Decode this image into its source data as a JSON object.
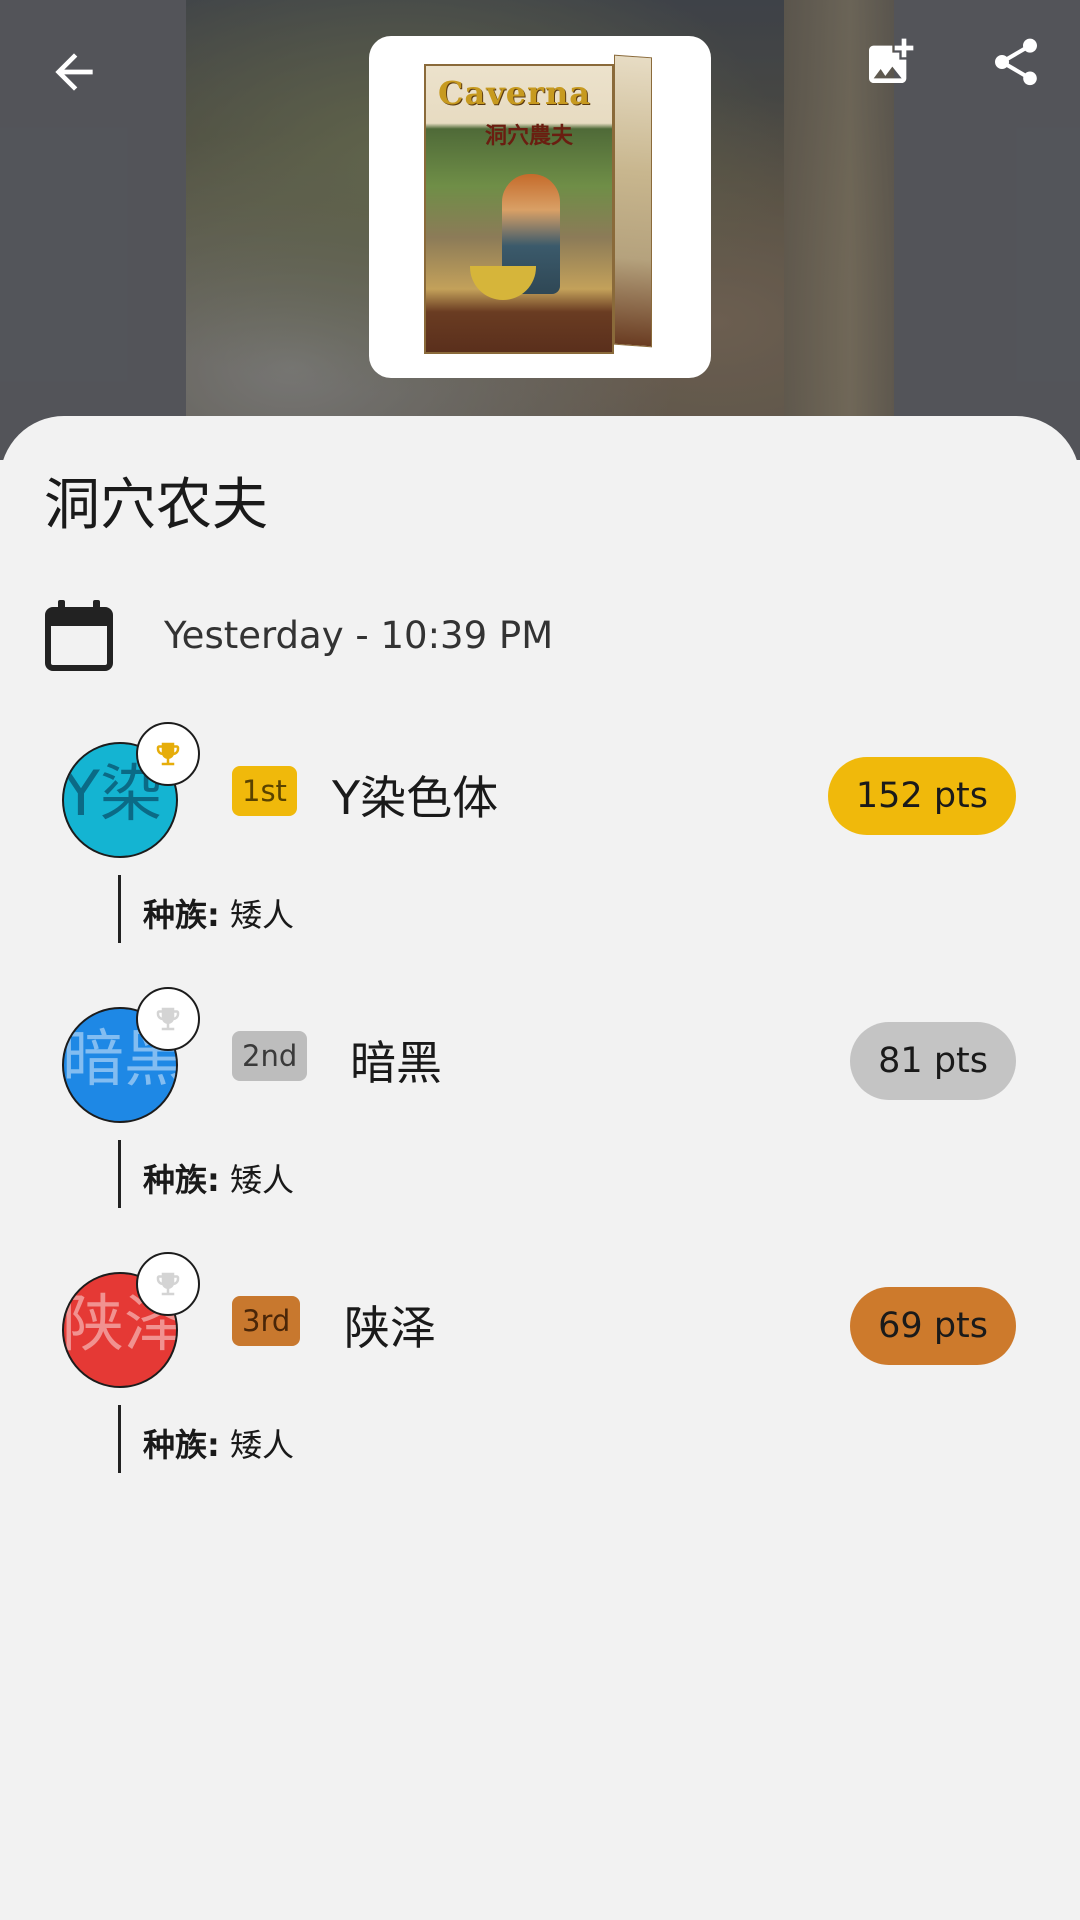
{
  "header": {
    "back_icon": "arrow-left-icon",
    "add_image_icon": "add-photo-icon",
    "share_icon": "share-icon",
    "cover": {
      "title": "Caverna",
      "subtitle": "洞穴農夫"
    }
  },
  "game": {
    "title": "洞穴农夫",
    "date": "Yesterday - 10:39 PM"
  },
  "players": [
    {
      "avatar_text": "Y染",
      "avatar_color": "#14b4d2",
      "place": "1st",
      "place_color": "#f0b90b",
      "name": "Y染色体",
      "score": "152 pts",
      "score_color": "#f0b90b",
      "trophy_color": "#e6ad0a",
      "race_label": "种族:",
      "race_value": "矮人"
    },
    {
      "avatar_text": "暗黑",
      "avatar_color": "#1e88e5",
      "place": "2nd",
      "place_color": "#bdbdbd",
      "name": "暗黑",
      "score": "81 pts",
      "score_color": "#c4c4c4",
      "trophy_color": "#d4d4d4",
      "race_label": "种族:",
      "race_value": "矮人"
    },
    {
      "avatar_text": "陕泽",
      "avatar_color": "#e53935",
      "place": "3rd",
      "place_color": "#c8782e",
      "name": "陕泽",
      "score": "69 pts",
      "score_color": "#cd7a2c",
      "trophy_color": "#d4d4d4",
      "race_label": "种族:",
      "race_value": "矮人"
    }
  ]
}
